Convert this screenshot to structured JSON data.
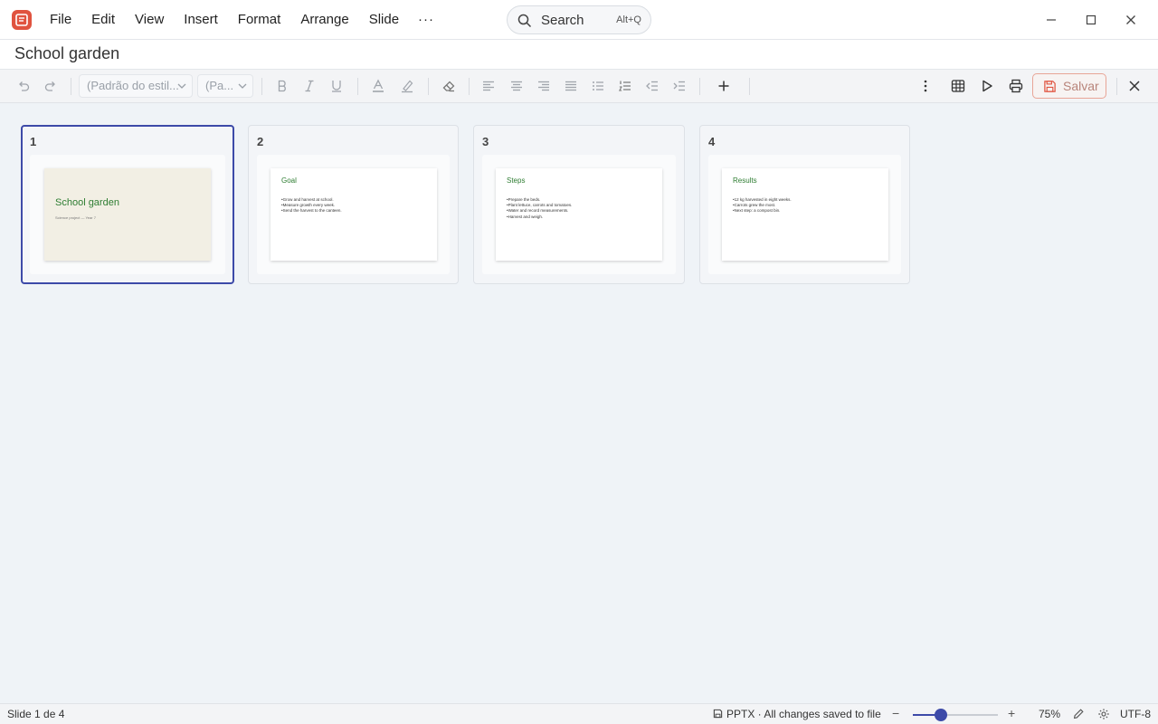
{
  "menu": {
    "items": [
      "File",
      "Edit",
      "View",
      "Insert",
      "Format",
      "Arrange",
      "Slide"
    ],
    "more": "···"
  },
  "search": {
    "label": "Search",
    "shortcut": "Alt+Q"
  },
  "document": {
    "title": "School garden"
  },
  "toolbar": {
    "style_select": "(Padrão do estil...",
    "size_select": "(Pa...",
    "save_label": "Salvar"
  },
  "slides": [
    {
      "number": "1",
      "title": "School garden",
      "subtitle": "Science project — Year 7"
    },
    {
      "number": "2",
      "title": "Goal",
      "bullets": [
        "•Grow and harvest at school.",
        "•Measure growth every week.",
        "•Send the harvest to the canteen."
      ]
    },
    {
      "number": "3",
      "title": "Steps",
      "bullets": [
        "•Prepare the beds.",
        "•Plant lettuce, carrots and tomatoes.",
        "•Water and record measurements.",
        "•Harvest and weigh."
      ]
    },
    {
      "number": "4",
      "title": "Results",
      "bullets": [
        "•12 kg harvested in eight weeks.",
        "•Carrots grew the most.",
        "•Next step: a compost bin."
      ]
    }
  ],
  "status": {
    "slide_position": "Slide 1 de 4",
    "file_state": "PPTX · All changes saved to file",
    "zoom_minus": "−",
    "zoom_plus": "+",
    "zoom_percent": 75,
    "zoom_fraction": 0.33,
    "zoom_level": "75%",
    "encoding": "UTF-8"
  },
  "colors": {
    "accent": "#3d4aa8",
    "app_logo": "#e0533f",
    "slide_title": "#2e7d32",
    "cover_background": "#f2efe4",
    "save_border": "#e8a597"
  }
}
